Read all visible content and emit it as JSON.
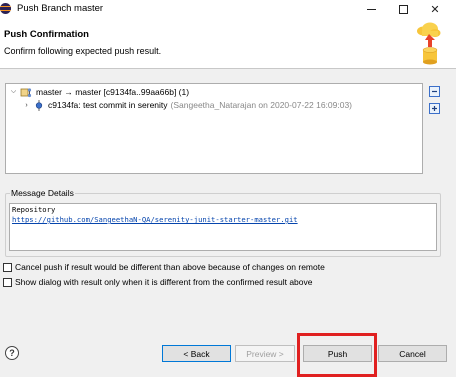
{
  "window": {
    "title": "Push Branch master"
  },
  "header": {
    "title": "Push Confirmation",
    "description": "Confirm following expected push result."
  },
  "tree": {
    "rows": [
      {
        "label": "master → master [c9134fa..99aa66b] (1)"
      },
      {
        "label": "c9134fa: test commit in serenity",
        "detail": "(Sangeetha_Natarajan on 2020-07-22 16:09:03)"
      }
    ]
  },
  "message": {
    "group_label": "Message Details",
    "line1": "Repository",
    "url": "https://github.com/SangeethaN-QA/serenity-junit-starter-master.git"
  },
  "options": {
    "cancel_if_different": "Cancel push if result would be different than above because of changes on remote",
    "show_dialog_if_different": "Show dialog with result only when it is different from the confirmed result above"
  },
  "buttons": {
    "help": "?",
    "back": "< Back",
    "next": "Preview >",
    "push": "Push",
    "cancel": "Cancel"
  },
  "icons": [
    "eclipse-icon",
    "minimize-icon",
    "maximize-icon",
    "close-icon",
    "push-banner-icon",
    "expand-arrow-icon",
    "repository-icon",
    "commit-icon",
    "collapse-all-icon",
    "expand-all-icon",
    "help-icon"
  ],
  "colors": {
    "highlight": "#e02020",
    "link": "#0645ad",
    "dialog_bg": "#f0f0f0"
  }
}
